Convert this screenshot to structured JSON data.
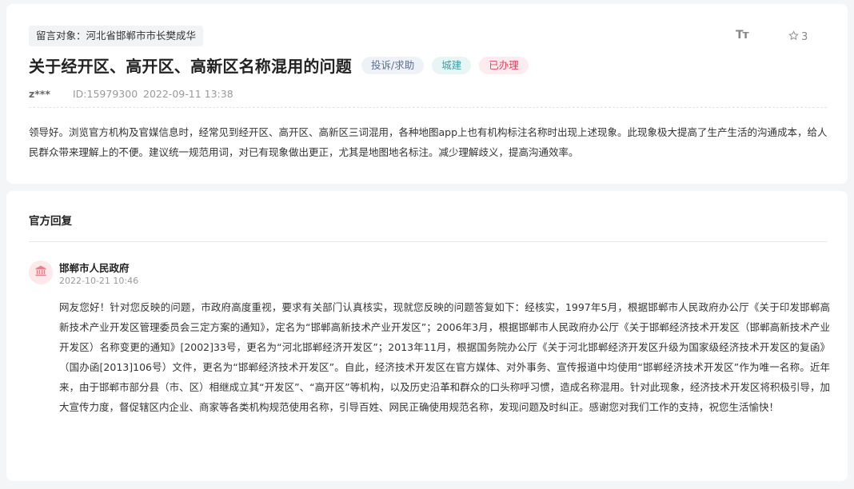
{
  "message": {
    "target_label": "留言对象：河北省邯郸市市长樊成华",
    "font_size_icon": "Tт",
    "favorite_count": "3",
    "title": "关于经开区、高开区、高新区名称混用的问题",
    "tags": {
      "category": "投诉/求助",
      "department": "城建",
      "status": "已办理"
    },
    "user": "z***",
    "id": "ID:15979300",
    "datetime": "2022-09-11 13:38",
    "content": "领导好。浏览官方机构及官媒信息时，经常见到经开区、高开区、高新区三词混用，各种地图app上也有机构标注名称时出现上述现象。此现象极大提高了生产生活的沟通成本，给人民群众带来理解上的不便。建议统一规范用词，对已有现象做出更正，尤其是地图地名标注。减少理解歧义，提高沟通效率。"
  },
  "reply": {
    "heading": "官方回复",
    "responder": "邯郸市人民政府",
    "datetime": "2022-10-21 10:46",
    "content": "网友您好！针对您反映的问题，市政府高度重视，要求有关部门认真核实，现就您反映的问题答复如下：经核实，1997年5月，根据邯郸市人民政府办公厅《关于印发邯郸高新技术产业开发区管理委员会三定方案的通知》，定名为“邯郸高新技术产业开发区”；2006年3月，根据邯郸市人民政府办公厅《关于邯郸经济技术开发区（邯郸高新技术产业开发区）名称变更的通知》[2002]33号，更名为“河北邯郸经济开发区”；2013年11月，根据国务院办公厅《关于河北邯郸经济开发区升级为国家级经济技术开发区的复函》（国办函[2013]106号）文件，更名为“邯郸经济技术开发区”。自此，经济技术开发区在官方媒体、对外事务、宣传报道中均使用“邯郸经济技术开发区”作为唯一名称。近年来，由于邯郸市部分县（市、区）相继成立其“开发区”、“高开区”等机构，以及历史沿革和群众的口头称呼习惯，造成名称混用。针对此现象，经济技术开发区将积极引导，加大宣传力度，督促辖区内企业、商家等各类机构规范使用名称，引导百姓、网民正确使用规范名称，发现问题及时纠正。感谢您对我们工作的支持，祝您生活愉快！"
  },
  "icons": {
    "favorite": "star-outline-icon",
    "avatar": "government-building-icon"
  },
  "colors": {
    "status_red": "#e0455f",
    "department_teal": "#3aa0a8",
    "avatar_bg": "#fde8ea"
  }
}
